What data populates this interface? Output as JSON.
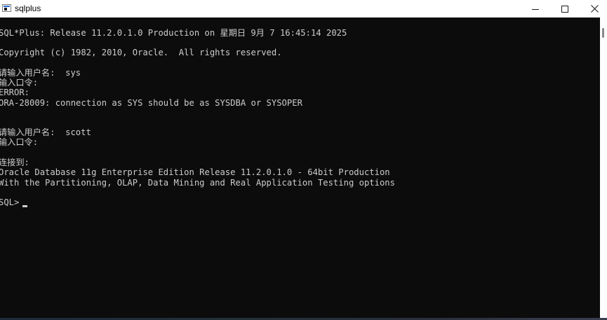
{
  "window": {
    "title": "sqlplus"
  },
  "icons": {
    "app": "console-window-icon",
    "minimize": "minimize-icon",
    "maximize": "maximize-icon",
    "close": "close-icon"
  },
  "console": {
    "text_color": "#cccccc",
    "background": "#0c0c0c",
    "lines": [
      "SQL*Plus: Release 11.2.0.1.0 Production on 星期日 9月 7 16:45:14 2025",
      "Copyright (c) 1982, 2010, Oracle.  All rights reserved.",
      "请输入用户名:  sys",
      "输入口令:",
      "ERROR:",
      "ORA-28009: connection as SYS should be as SYSDBA or SYSOPER",
      "请输入用户名:  scott",
      "输入口令:",
      "连接到:",
      "Oracle Database 11g Enterprise Edition Release 11.2.0.1.0 - 64bit Production",
      "With the Partitioning, OLAP, Data Mining and Real Application Testing options",
      "SQL> "
    ]
  }
}
